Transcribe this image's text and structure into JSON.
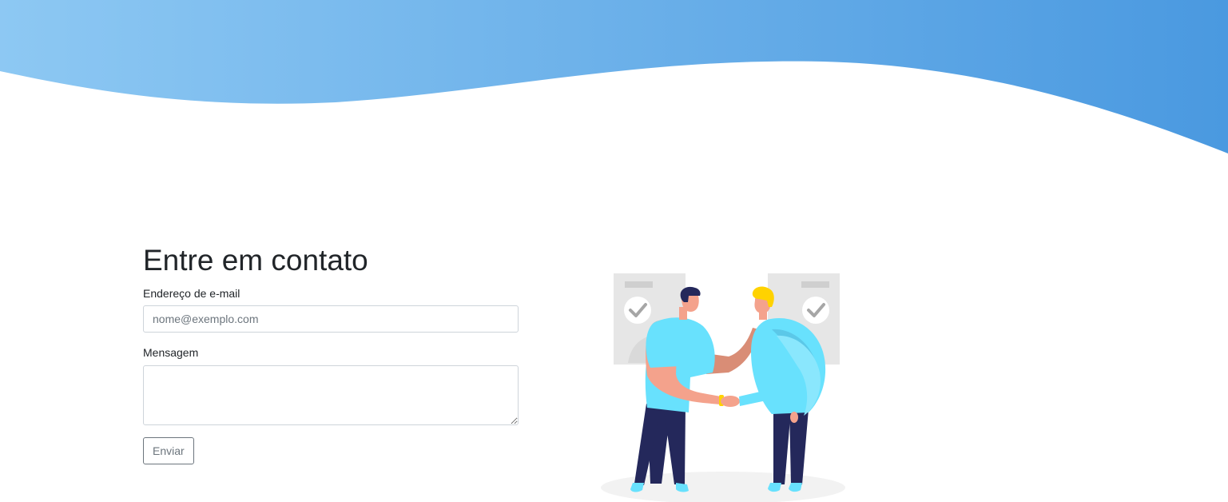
{
  "colors": {
    "wave_start": "#8dc8f3",
    "wave_end": "#4a99e0",
    "text": "#212529",
    "border": "#ced4da",
    "button": "#6c757d"
  },
  "contact": {
    "title": "Entre em contato",
    "email_label": "Endereço de e-mail",
    "email_placeholder": "nome@exemplo.com",
    "email_value": "",
    "message_label": "Mensagem",
    "message_value": "",
    "submit_label": "Enviar"
  },
  "illustration": {
    "subject": "handshake-illustration",
    "icons": [
      "check-icon",
      "check-icon"
    ]
  }
}
